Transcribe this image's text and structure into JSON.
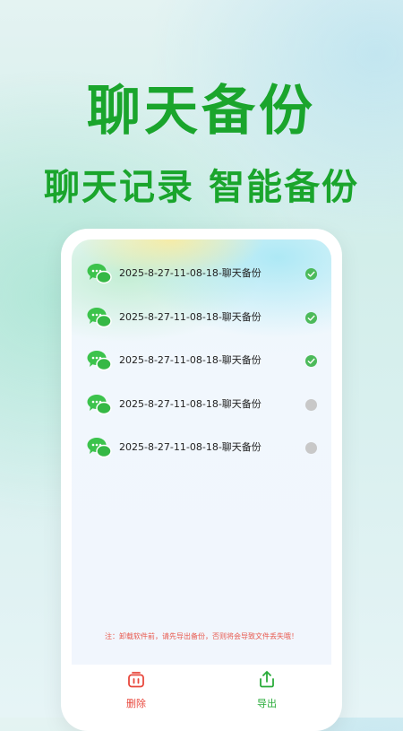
{
  "hero": {
    "title": "聊天备份",
    "subtitle": "聊天记录 智能备份"
  },
  "backup_list": {
    "items": [
      {
        "label": "2025-8-27-11-08-18-聊天备份",
        "selected": true
      },
      {
        "label": "2025-8-27-11-08-18-聊天备份",
        "selected": true
      },
      {
        "label": "2025-8-27-11-08-18-聊天备份",
        "selected": true
      },
      {
        "label": "2025-8-27-11-08-18-聊天备份",
        "selected": false
      },
      {
        "label": "2025-8-27-11-08-18-聊天备份",
        "selected": false
      }
    ]
  },
  "notice": "注：卸载软件前，请先导出备份，否则将会导致文件丢失哦！",
  "bottom_bar": {
    "delete_label": "删除",
    "export_label": "导出"
  },
  "colors": {
    "brand_green": "#1aa52c",
    "checked": "#4cba5a",
    "unchecked": "#c8c8c8",
    "danger": "#e8483d"
  },
  "icons": {
    "item": "chat-bubble-icon",
    "delete": "trash-icon",
    "export": "share-upload-icon"
  }
}
